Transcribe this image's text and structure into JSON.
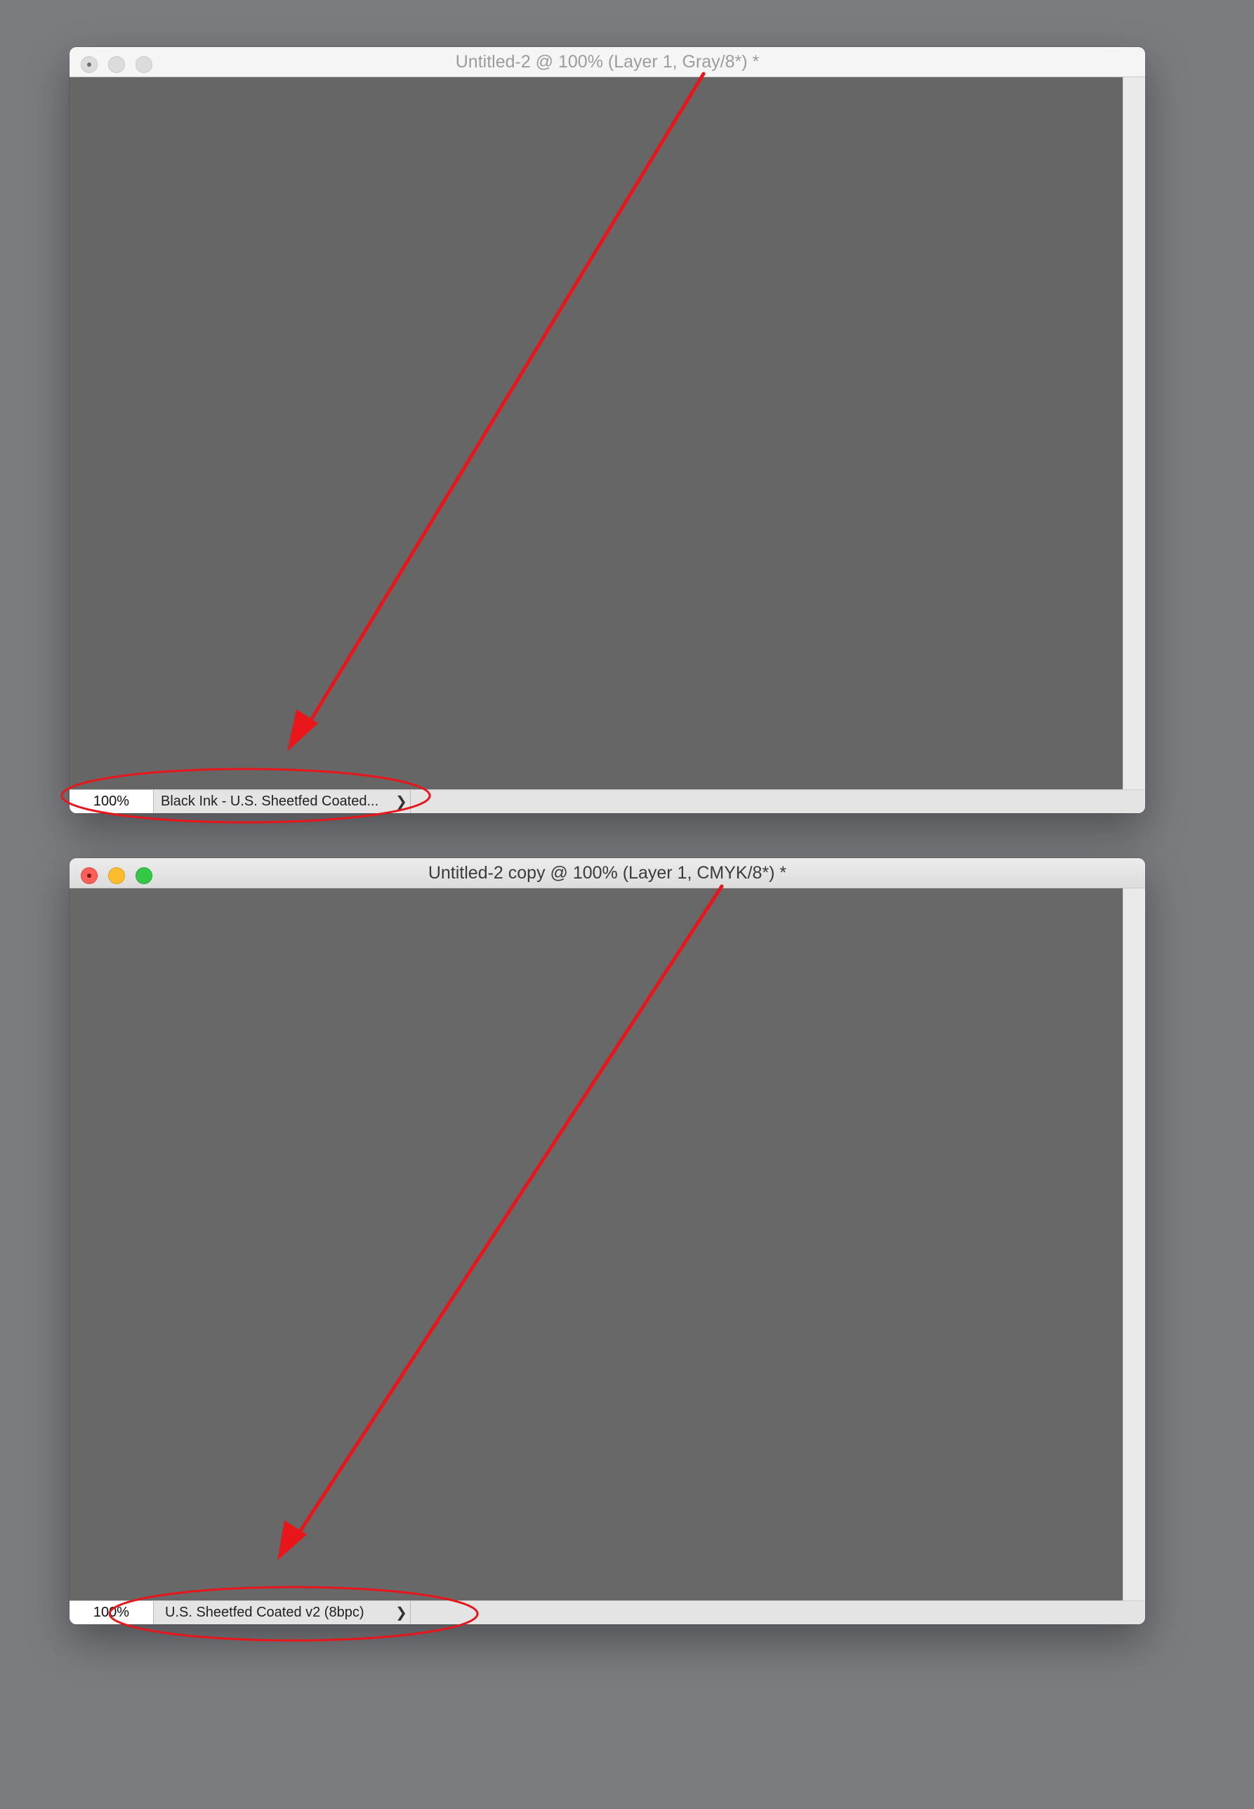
{
  "windows": [
    {
      "title": "Untitled-2 @ 100% (Layer 1, Gray/8*) *",
      "zoom": "100%",
      "doc_info": "Black Ink - U.S. Sheetfed Coated...",
      "chevron": "❯"
    },
    {
      "title": "Untitled-2 copy @ 100% (Layer 1, CMYK/8*) *",
      "zoom": "100%",
      "doc_info": "U.S. Sheetfed Coated v2 (8bpc)",
      "chevron": "❯"
    }
  ],
  "colors": {
    "desktop": "#7b7c80",
    "canvas": "#666666",
    "annotation": "#e8161b",
    "traffic_close": "#fc5f57",
    "traffic_minimize": "#fdbc2e",
    "traffic_maximize": "#34c748"
  }
}
